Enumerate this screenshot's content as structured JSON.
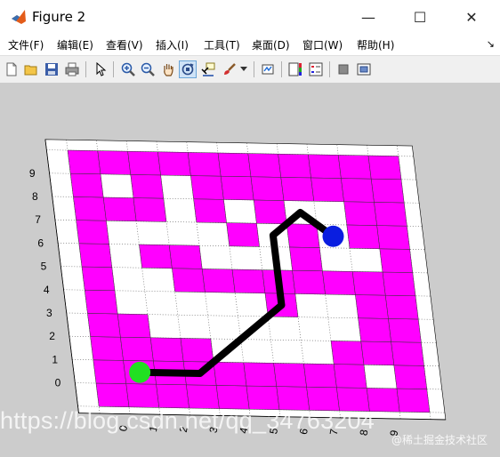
{
  "window": {
    "title": "Figure 2",
    "minimize": "—",
    "maximize": "☐",
    "close": "✕"
  },
  "menu": {
    "items": [
      "文件(F)",
      "编辑(E)",
      "查看(V)",
      "插入(I)",
      "工具(T)",
      "桌面(D)",
      "窗口(W)",
      "帮助(H)"
    ],
    "overflow": "↘"
  },
  "toolbar": {
    "icons": [
      "new-figure-icon",
      "open-file-icon",
      "save-icon",
      "print-icon",
      "edit-plot-arrow-icon",
      "zoom-in-icon",
      "zoom-out-icon",
      "pan-hand-icon",
      "rotate-3d-icon",
      "data-cursor-icon",
      "brush-icon",
      "link-plot-icon",
      "colorbar-icon",
      "legend-icon",
      "hide-plot-tools-icon",
      "show-plot-tools-icon"
    ],
    "active": "rotate-3d-icon"
  },
  "chart_data": {
    "type": "heatmap",
    "title": "",
    "xlabel": "",
    "ylabel": "",
    "xlim": [
      0,
      11
    ],
    "ylim": [
      -1,
      10
    ],
    "grid": true,
    "x_ticks": [
      "0",
      "1",
      "2",
      "3",
      "4",
      "5",
      "6",
      "7",
      "8",
      "9"
    ],
    "y_ticks": [
      "0",
      "1",
      "2",
      "3",
      "4",
      "5",
      "6",
      "7",
      "8",
      "9"
    ],
    "cell_color": "#ff00ff",
    "background_color": "#ffffff",
    "obstacle_cells": [
      [
        0,
        -1
      ],
      [
        1,
        -1
      ],
      [
        2,
        -1
      ],
      [
        3,
        -1
      ],
      [
        4,
        -1
      ],
      [
        5,
        -1
      ],
      [
        6,
        -1
      ],
      [
        7,
        -1
      ],
      [
        8,
        -1
      ],
      [
        9,
        -1
      ],
      [
        10,
        -1
      ],
      [
        0,
        9
      ],
      [
        1,
        9
      ],
      [
        2,
        9
      ],
      [
        3,
        9
      ],
      [
        4,
        9
      ],
      [
        5,
        9
      ],
      [
        6,
        9
      ],
      [
        7,
        9
      ],
      [
        8,
        9
      ],
      [
        9,
        9
      ],
      [
        10,
        9
      ],
      [
        0,
        0
      ],
      [
        0,
        1
      ],
      [
        0,
        2
      ],
      [
        0,
        3
      ],
      [
        0,
        4
      ],
      [
        0,
        5
      ],
      [
        0,
        6
      ],
      [
        0,
        7
      ],
      [
        0,
        8
      ],
      [
        10,
        0
      ],
      [
        10,
        1
      ],
      [
        10,
        2
      ],
      [
        10,
        3
      ],
      [
        10,
        4
      ],
      [
        10,
        5
      ],
      [
        10,
        6
      ],
      [
        10,
        7
      ],
      [
        10,
        8
      ],
      [
        2,
        8
      ],
      [
        4,
        8
      ],
      [
        5,
        8
      ],
      [
        6,
        8
      ],
      [
        7,
        8
      ],
      [
        8,
        8
      ],
      [
        9,
        8
      ],
      [
        1,
        7
      ],
      [
        2,
        7
      ],
      [
        4,
        7
      ],
      [
        6,
        7
      ],
      [
        9,
        7
      ],
      [
        5,
        6
      ],
      [
        7,
        6
      ],
      [
        9,
        6
      ],
      [
        2,
        5
      ],
      [
        3,
        5
      ],
      [
        7,
        5
      ],
      [
        3,
        4
      ],
      [
        4,
        4
      ],
      [
        5,
        4
      ],
      [
        6,
        4
      ],
      [
        7,
        4
      ],
      [
        8,
        4
      ],
      [
        9,
        4
      ],
      [
        6,
        3
      ],
      [
        9,
        3
      ],
      [
        1,
        2
      ],
      [
        9,
        2
      ],
      [
        1,
        1
      ],
      [
        2,
        1
      ],
      [
        3,
        1
      ],
      [
        8,
        1
      ],
      [
        9,
        1
      ],
      [
        1,
        0
      ],
      [
        2,
        0
      ],
      [
        3,
        0
      ],
      [
        4,
        0
      ],
      [
        5,
        0
      ],
      [
        6,
        0
      ],
      [
        7,
        0
      ],
      [
        8,
        0
      ]
    ],
    "path": {
      "color": "#000000",
      "x": [
        1,
        3,
        5,
        6,
        6,
        7,
        8
      ],
      "y": [
        0,
        0,
        2,
        3,
        6,
        7,
        6
      ]
    },
    "start": {
      "x": 1,
      "y": 0,
      "color": "#22e022"
    },
    "goal": {
      "x": 8,
      "y": 6,
      "color": "#0a1ee0"
    }
  },
  "watermark": {
    "main": "https://blog.csdn.net/qq_34763204",
    "secondary": "@稀土掘金技术社区"
  }
}
